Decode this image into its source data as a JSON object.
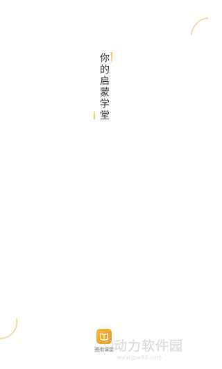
{
  "splash": {
    "tagline": "你的启蒙学堂"
  },
  "app": {
    "name": "雅雨课堂",
    "icon": "book-icon"
  },
  "watermark": {
    "title": "动力软件园",
    "url": "www.jpw88.com"
  },
  "colors": {
    "background": "#ffffff",
    "accent": "#f5b942",
    "accent_dark": "#e09a1f",
    "text": "#333333"
  }
}
